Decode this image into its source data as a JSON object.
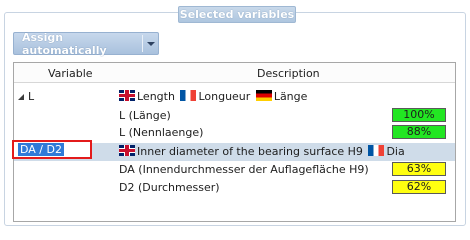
{
  "group": {
    "title": "Selected variables"
  },
  "toolbar": {
    "assign_label": "Assign automatically"
  },
  "grid": {
    "headers": {
      "variable": "Variable",
      "description": "Description"
    },
    "rows": [
      {
        "variable": "L",
        "translations": [
          {
            "flag": "uk",
            "text": "Length"
          },
          {
            "flag": "fr",
            "text": "Longueur"
          },
          {
            "flag": "de",
            "text": "Länge"
          }
        ],
        "children": [
          {
            "name": "L (Länge)",
            "match": "100%",
            "level": "green"
          },
          {
            "name": "L (Nennlaenge)",
            "match": "88%",
            "level": "green"
          }
        ]
      },
      {
        "variable": "DA / D2",
        "translations": [
          {
            "flag": "uk",
            "text": "Inner diameter of the bearing surface H9"
          },
          {
            "flag": "fr",
            "text": "Dia"
          }
        ],
        "children": [
          {
            "name": "DA (Innendurchmesser der Auflagefläche H9)",
            "match": "63%",
            "level": "yellow"
          },
          {
            "name": "D2 (Durchmesser)",
            "match": "62%",
            "level": "yellow"
          }
        ]
      }
    ]
  }
}
